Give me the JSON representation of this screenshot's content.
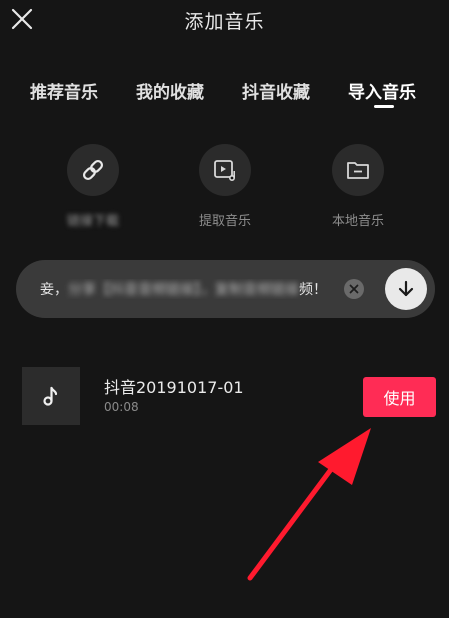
{
  "header": {
    "title": "添加音乐"
  },
  "tabs": [
    {
      "label": "推荐音乐"
    },
    {
      "label": "我的收藏"
    },
    {
      "label": "抖音收藏"
    },
    {
      "label": "导入音乐",
      "active": true
    }
  ],
  "actions": [
    {
      "label": "链接下载",
      "icon": "link-icon"
    },
    {
      "label": "提取音乐",
      "icon": "video-music-icon"
    },
    {
      "label": "本地音乐",
      "icon": "folder-icon"
    }
  ],
  "paste_bar": {
    "prefix": "妾，",
    "blurred_text": "分享【抖音音频链接】，复制音频链接",
    "suffix": "频！"
  },
  "music_list": [
    {
      "name": "抖音20191017-01",
      "duration": "00:08",
      "use_label": "使用"
    }
  ],
  "colors": {
    "background": "#151515",
    "accent": "#ff2c55",
    "annotation_arrow": "#ff1a2e"
  }
}
